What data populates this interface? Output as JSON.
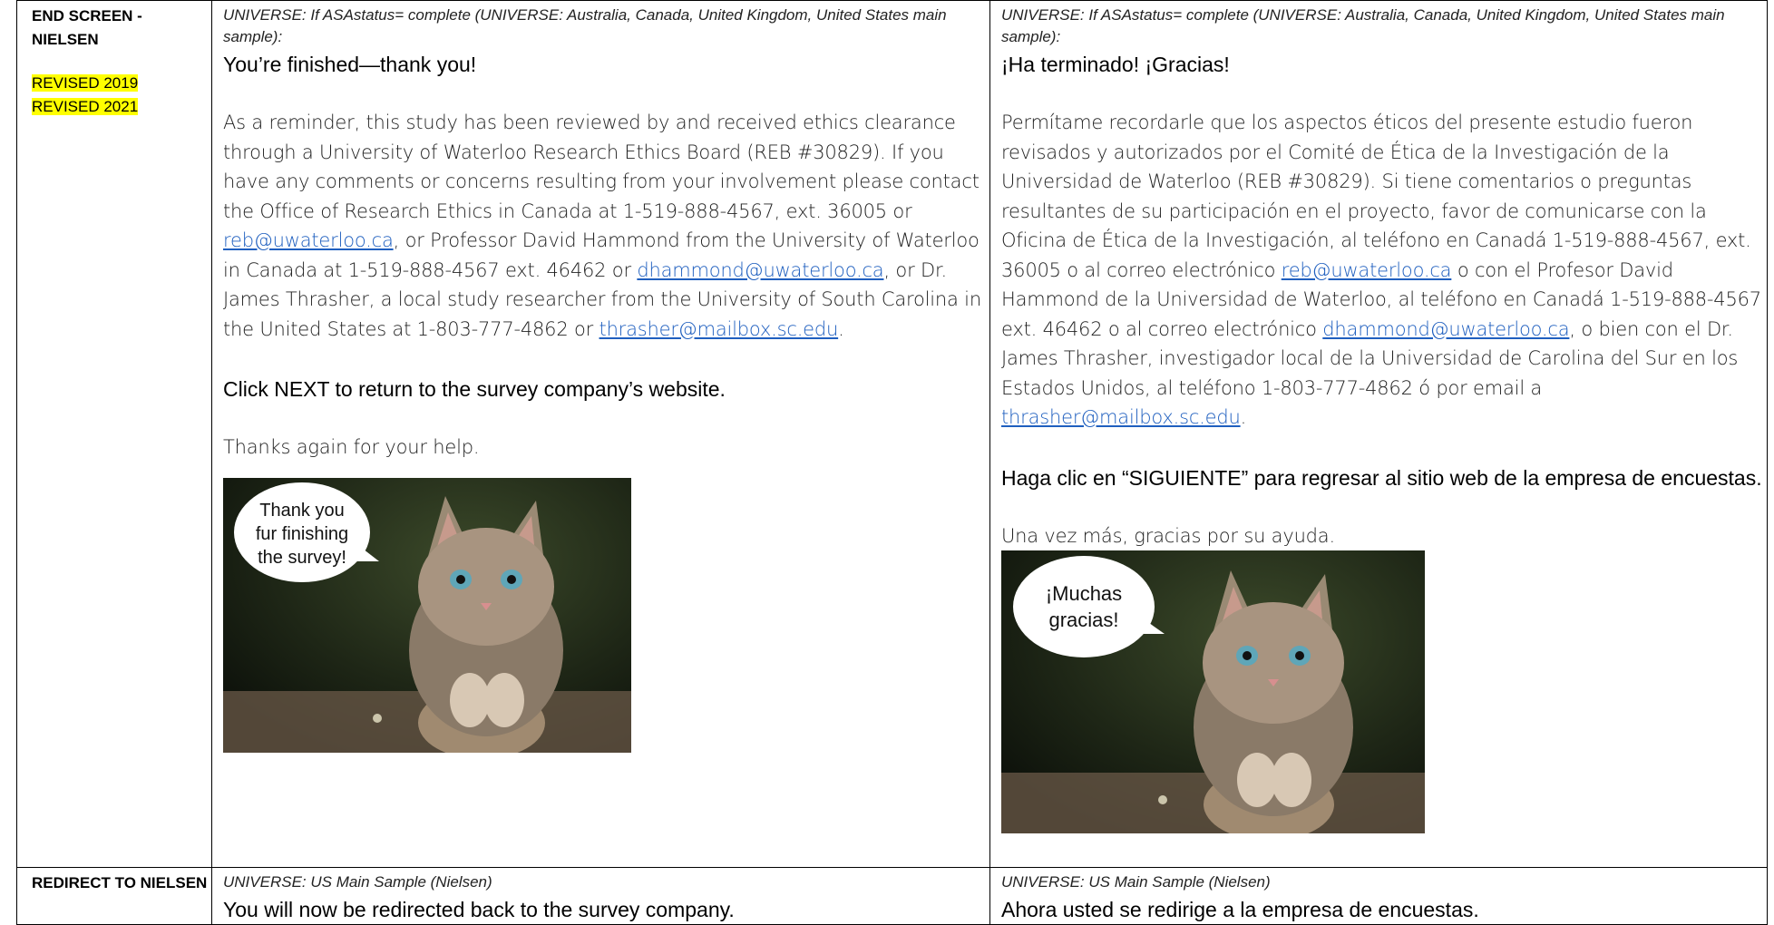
{
  "row1": {
    "label_line1": "END SCREEN -",
    "label_line2": "NIELSEN",
    "revised_1": "REVISED 2019",
    "revised_2": "REVISED 2021",
    "en": {
      "universe": "UNIVERSE: If ASAstatus= complete (UNIVERSE: Australia, Canada, United Kingdom, United States main sample):",
      "heading": "You’re finished—thank you!",
      "p1_a": "As a reminder, this study has been reviewed by and received ethics clearance through a University of Waterloo Research Ethics Board (REB #30829). If you have any comments or concerns resulting from your involvement please contact the Office of Research Ethics in Canada at 1-519-888-4567, ext. 36005 or ",
      "email1": "reb@uwaterloo.ca",
      "p1_b": ", or Professor David Hammond from the University of Waterloo in Canada at 1-519-888-4567 ext. 46462 or ",
      "email2": "dhammond@uwaterloo.ca",
      "p1_c": ", or Dr. James Thrasher, a local study researcher from the University of South Carolina in the United States at 1-803-777-4862 or ",
      "email3": "thrasher@mailbox.sc.edu",
      "p1_d": ".",
      "next": "Click NEXT to return to the survey company’s website.",
      "thanks": "Thanks again for your help.",
      "bubble_l1": "Thank you",
      "bubble_l2": "fur finishing",
      "bubble_l3": "the survey!"
    },
    "es": {
      "universe": "UNIVERSE: If ASAstatus= complete (UNIVERSE: Australia, Canada, United Kingdom, United States main sample):",
      "heading": "¡Ha terminado! ¡Gracias!",
      "p1_a": "Permítame recordarle que los aspectos éticos del presente estudio fueron revisados y autorizados por el Comité de Ética de la Investigación de la Universidad de Waterloo (REB #30829). Si tiene comentarios o preguntas resultantes de su participación en el proyecto, favor de comunicarse con la Oficina de Ética de la Investigación, al teléfono en Canadá 1-519-888-4567, ext. 36005 o al correo electrónico ",
      "email1": "reb@uwaterloo.ca",
      "p1_b": " o con el Profesor David Hammond de la Universidad de Waterloo, al teléfono en Canadá 1-519-888-4567 ext. 46462 o al correo electrónico ",
      "email2": "dhammond@uwaterloo.ca",
      "p1_c": ", o bien con el Dr. James Thrasher, investigador local de la Universidad de Carolina del Sur en los Estados Unidos, al teléfono 1-803-777-4862 ó por email a ",
      "email3": "thrasher@mailbox.sc.edu",
      "p1_d": ".",
      "next": "Haga clic en “SIGUIENTE” para regresar al sitio web de la empresa de encuestas.",
      "thanks": "Una vez más, gracias por su ayuda.",
      "bubble_l1": "¡Muchas",
      "bubble_l2": "gracias!"
    }
  },
  "row2": {
    "label": "REDIRECT TO NIELSEN",
    "en": {
      "universe": "UNIVERSE: US Main Sample (Nielsen)",
      "heading": "You will now be redirected back to the survey company."
    },
    "es": {
      "universe": "UNIVERSE: US Main Sample (Nielsen)",
      "heading": "Ahora usted se redirige a la empresa de encuestas."
    }
  }
}
